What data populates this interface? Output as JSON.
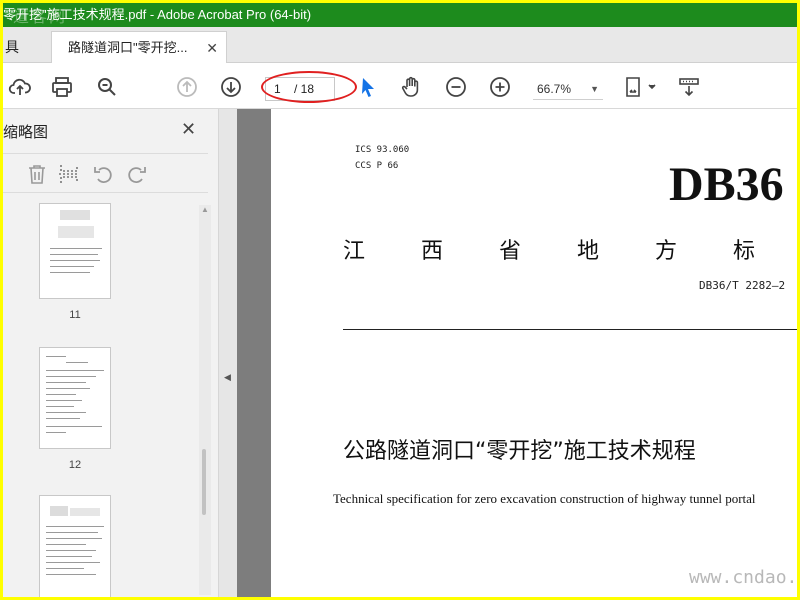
{
  "window": {
    "title": "零开挖\"施工技术规程.pdf - Adobe Acrobat Pro (64-bit)",
    "watermark_text": "道客网"
  },
  "tabs": {
    "partial_label": "具",
    "active_label": "路隧道洞口\"零开挖...",
    "close_glyph": "✕"
  },
  "toolbar": {
    "current_page": "1",
    "total_pages": "/ 18",
    "zoom": "66.7%",
    "zoom_caret": "▼",
    "icons": [
      "cloud-upload-icon",
      "print-icon",
      "zoom-search-icon",
      "previous-page-icon",
      "next-page-icon",
      "select-arrow-icon",
      "hand-icon",
      "zoom-out-icon",
      "zoom-in-icon",
      "fit-page-icon",
      "scroll-mode-icon"
    ]
  },
  "sidebar": {
    "title": "缩略图",
    "close_glyph": "✕",
    "tools": [
      "delete-icon",
      "extract-icon",
      "rotate-left-icon",
      "rotate-right-icon"
    ],
    "thumbnails": [
      {
        "label": "11"
      },
      {
        "label": "12"
      },
      {
        "label": ""
      }
    ],
    "collapse_glyph": "◀"
  },
  "document": {
    "ics": "ICS 93.060",
    "ccs": "CCS P 66",
    "standard_mark": "DB36",
    "province_line": "江西省地方标",
    "code": "DB36/T 2282—2",
    "title_cn": "公路隧道洞口“零开挖”施工技术规程",
    "title_en": "Technical specification for zero excavation construction of highway tunnel portal",
    "footer_watermark": "www.cndao.com"
  },
  "colors": {
    "title_bar": "#1d8b1d",
    "border": "#ffff00",
    "annotation_circle": "#e02020",
    "select_tool": "#1473e6"
  }
}
